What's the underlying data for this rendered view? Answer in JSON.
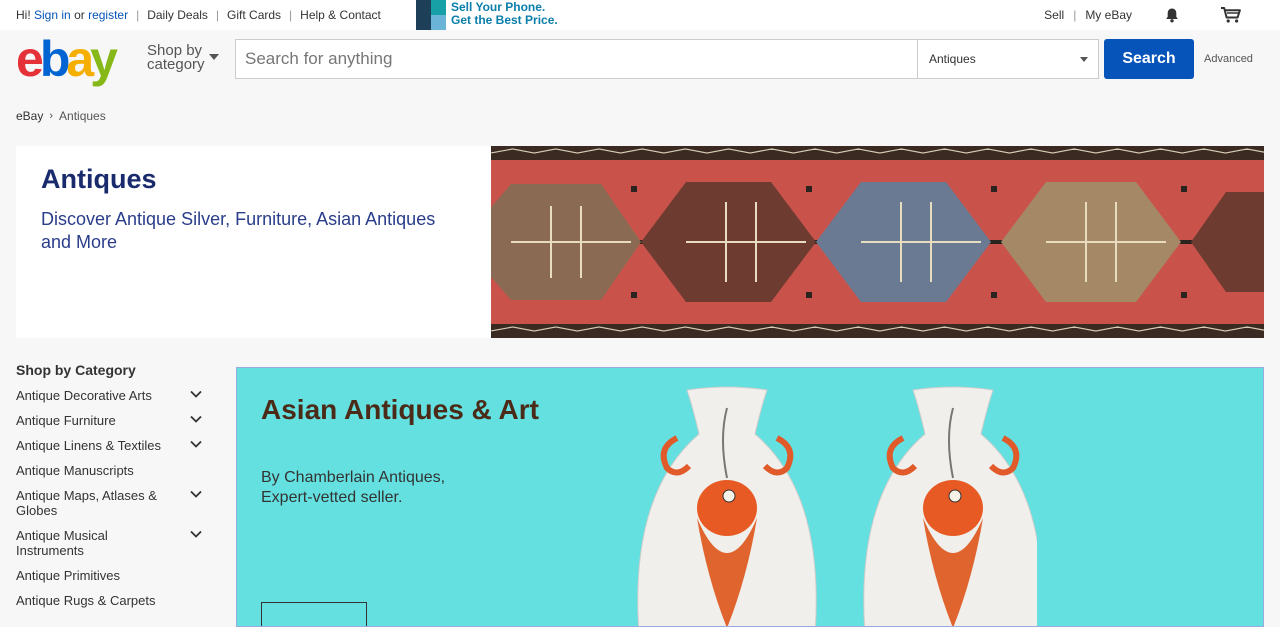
{
  "topbar": {
    "greeting": "Hi!",
    "sign_in": "Sign in",
    "or": "or",
    "register": "register",
    "links": [
      "Daily Deals",
      "Gift Cards",
      "Help & Contact"
    ],
    "promo_line1": "Sell Your Phone.",
    "promo_line2": "Get the Best Price.",
    "sell": "Sell",
    "my_ebay": "My eBay",
    "icons": [
      "bell-icon",
      "cart-icon"
    ]
  },
  "header": {
    "logo_letters": [
      "e",
      "b",
      "a",
      "y"
    ],
    "logo_colors": [
      "#e53238",
      "#0064d2",
      "#f5af02",
      "#86b817"
    ],
    "shop_by_line1": "Shop by",
    "shop_by_line2": "category",
    "search_placeholder": "Search for anything",
    "category_selected": "Antiques",
    "search_button": "Search",
    "advanced": "Advanced"
  },
  "breadcrumb": {
    "home": "eBay",
    "current": "Antiques"
  },
  "hero": {
    "title": "Antiques",
    "subtitle": "Discover Antique Silver, Furniture, Asian Antiques and More"
  },
  "sidebar": {
    "title": "Shop by Category",
    "items": [
      {
        "label": "Antique Decorative Arts",
        "expandable": true
      },
      {
        "label": "Antique Furniture",
        "expandable": true
      },
      {
        "label": "Antique Linens & Textiles",
        "expandable": true
      },
      {
        "label": "Antique Manuscripts",
        "expandable": false
      },
      {
        "label": "Antique Maps, Atlases & Globes",
        "expandable": true
      },
      {
        "label": "Antique Musical Instruments",
        "expandable": true
      },
      {
        "label": "Antique Primitives",
        "expandable": false
      },
      {
        "label": "Antique Rugs & Carpets",
        "expandable": false
      }
    ]
  },
  "promo_card": {
    "title": "Asian Antiques & Art",
    "subtitle": "By Chamberlain Antiques, Expert-vetted seller.",
    "background": "#64e0e0"
  }
}
